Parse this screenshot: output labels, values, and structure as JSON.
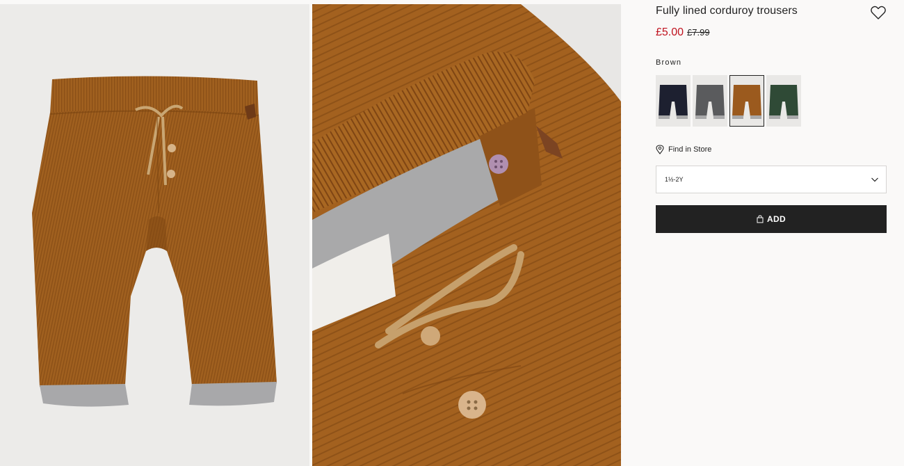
{
  "product": {
    "title": "Fully lined corduroy trousers",
    "price_current": "£5.00",
    "price_original": "£7.99",
    "color_label": "Brown",
    "swatches": [
      {
        "name": "navy",
        "color": "#1d2030",
        "selected": false
      },
      {
        "name": "grey",
        "color": "#5a5b5d",
        "selected": false
      },
      {
        "name": "brown",
        "color": "#9b5a1e",
        "selected": true
      },
      {
        "name": "green",
        "color": "#2f4a36",
        "selected": false
      }
    ],
    "find_in_store": "Find in Store",
    "size_selected": "1½-2Y",
    "add_label": "ADD"
  },
  "colors": {
    "sale_price": "#c0131f",
    "button_bg": "#222222",
    "corduroy": "#9b5a1e",
    "lining": "#a9a9aa"
  },
  "icons": {
    "favorite": "heart-outline-icon",
    "store": "location-pin-icon",
    "dropdown": "chevron-down-icon",
    "bag": "shopping-bag-icon"
  }
}
